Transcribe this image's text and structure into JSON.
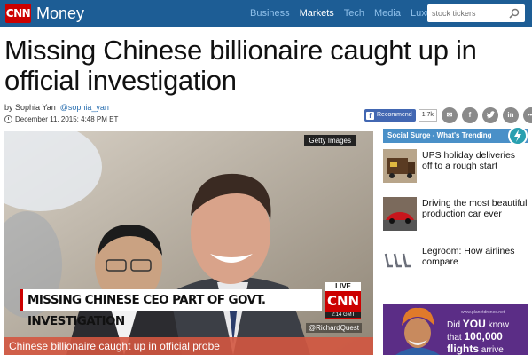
{
  "nav": {
    "logo_text": "CNN",
    "brand": "Money",
    "links": [
      "Business",
      "Markets",
      "Tech",
      "Media",
      "Luxury"
    ],
    "active": "Markets",
    "search_placeholder": "stock tickers"
  },
  "article": {
    "headline": "Missing Chinese billionaire caught up in official investigation",
    "author": "by Sophia Yan",
    "author_handle": "@sophia_yan",
    "date": "December 11, 2015: 4:48 PM ET"
  },
  "social": {
    "recommend_label": "Recommend",
    "recommend_count": "1.7k",
    "share_icons": [
      "email-icon",
      "facebook-icon",
      "twitter-icon",
      "linkedin-icon",
      "more-icon"
    ]
  },
  "media": {
    "credit": "Getty Images",
    "chyron": "MISSING CHINESE CEO PART OF GOVT. INVESTIGATION",
    "live_label": "LIVE",
    "live_network": "CNN",
    "live_time": "2:14 GMT",
    "twitter_handle": "@RichardQuest",
    "caption": "Chinese billionaire caught up in official probe"
  },
  "rail": {
    "header": "Social Surge - What's Trending",
    "items": [
      {
        "title": "UPS holiday deliveries off to a rough start"
      },
      {
        "title": "Driving the most beautiful production car ever"
      },
      {
        "title": "Legroom: How airlines compare"
      }
    ]
  },
  "ad": {
    "url": "www.planetdrones.net",
    "line1": "Did",
    "line1_bold": "YOU",
    "line1_end": "know",
    "line2": "that",
    "line2_bold": "100,000",
    "line3_bold": "flights",
    "line3_end": "arrive"
  },
  "colors": {
    "nav_bg": "#1d5d95",
    "accent_red": "#cc0000",
    "caption_bg": "#d35640",
    "rail_header": "#4a90c8",
    "ad_bg": "#5b2d86"
  }
}
